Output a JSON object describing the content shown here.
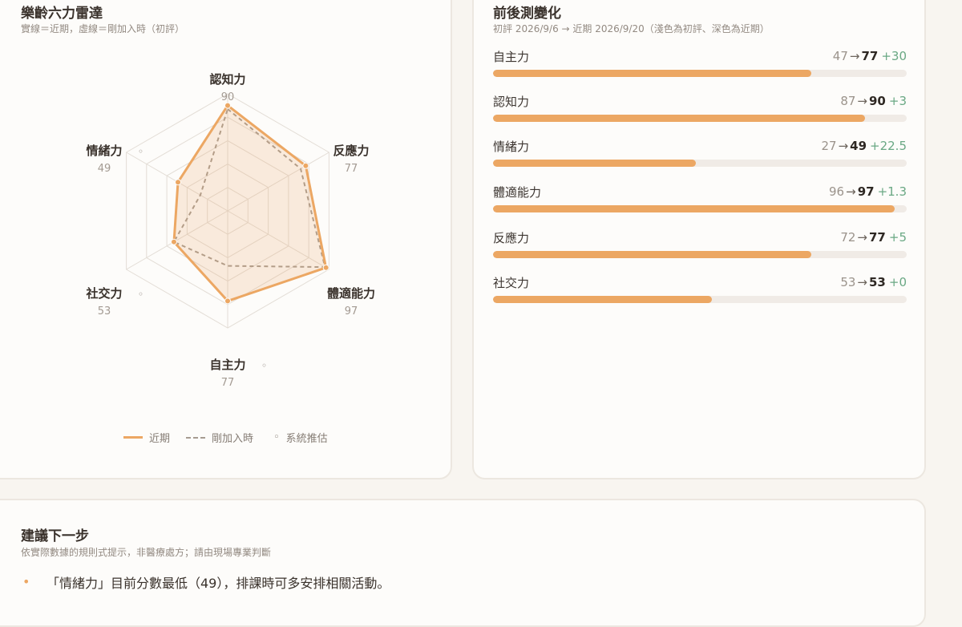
{
  "radar": {
    "title": "樂齡六力雷達",
    "subtitle": "實線＝近期，虛線＝剛加入時（初評）",
    "legend": {
      "recent": "近期",
      "initial": "剛加入時",
      "estimated": "系統推估"
    },
    "estimated_marker": "◦",
    "max": 100,
    "rings": 5
  },
  "chart_data": {
    "type": "radar",
    "title": "樂齡六力雷達",
    "axes": [
      "認知力",
      "反應力",
      "體適能力",
      "自主力",
      "社交力",
      "情緒力"
    ],
    "estimated": [
      false,
      false,
      false,
      true,
      true,
      true
    ],
    "range": [
      0,
      100
    ],
    "series": [
      {
        "name": "近期",
        "values": [
          90,
          77,
          97,
          77,
          53,
          49
        ],
        "color": "#eca763",
        "style": "solid"
      },
      {
        "name": "剛加入時",
        "values": [
          87,
          72,
          96,
          47,
          53,
          27
        ],
        "color": "#a69b91",
        "style": "dashed"
      }
    ]
  },
  "changes": {
    "title": "前後測變化",
    "subtitle": "初評 2026/9/6 → 近期 2026/9/20（淺色為初評、深色為近期）",
    "arrow": "→",
    "items": [
      {
        "label": "自主力",
        "before": "47",
        "after": "77",
        "delta": "+30",
        "progress": 0.77
      },
      {
        "label": "認知力",
        "before": "87",
        "after": "90",
        "delta": "+3",
        "progress": 0.9
      },
      {
        "label": "情緒力",
        "before": "27",
        "after": "49",
        "delta": "+22.5",
        "progress": 0.49
      },
      {
        "label": "體適能力",
        "before": "96",
        "after": "97",
        "delta": "+1.3",
        "progress": 0.97
      },
      {
        "label": "反應力",
        "before": "72",
        "after": "77",
        "delta": "+5",
        "progress": 0.77
      },
      {
        "label": "社交力",
        "before": "53",
        "after": "53",
        "delta": "+0",
        "progress": 0.53
      }
    ]
  },
  "next": {
    "title": "建議下一步",
    "subtitle": "依實際數據的規則式提示，非醫療處方；請由現場專業判斷",
    "bullet": "•",
    "items": [
      "「情緒力」目前分數最低（49），排課時可多安排相關活動。"
    ]
  },
  "colors": {
    "accent": "#eca763",
    "dashed": "#a69b91",
    "delta": "#6aa884",
    "track": "#f0ebe6"
  }
}
